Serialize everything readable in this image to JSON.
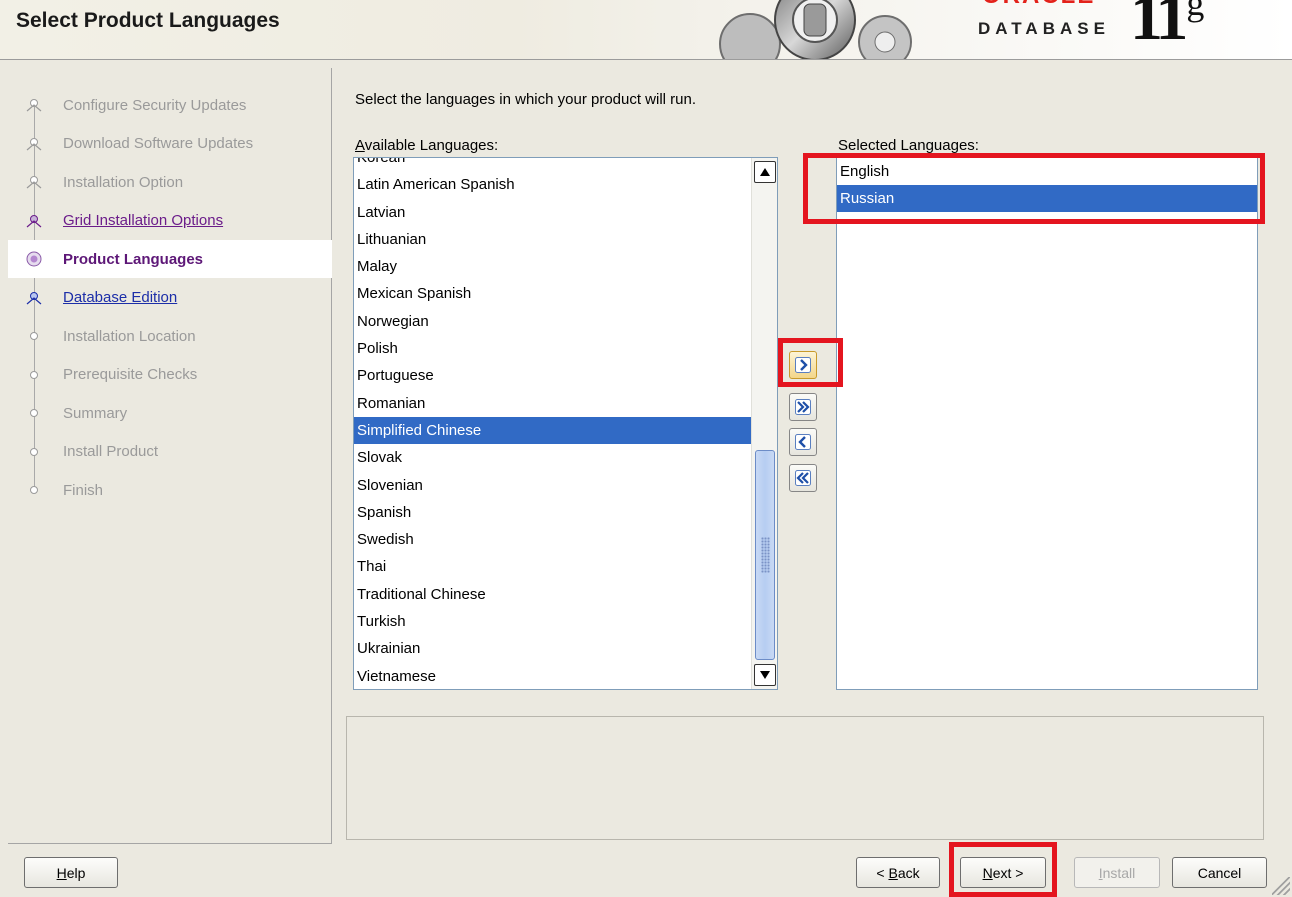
{
  "header": {
    "title": "Select Product Languages",
    "logo": {
      "brand": "ORACLE",
      "product": "DATABASE",
      "version": "11",
      "version_suffix": "g"
    }
  },
  "steps": [
    {
      "label": "Configure Security Updates",
      "state": "done"
    },
    {
      "label": "Download Software Updates",
      "state": "done"
    },
    {
      "label": "Installation Option",
      "state": "done"
    },
    {
      "label": "Grid Installation Options",
      "state": "visited-link"
    },
    {
      "label": "Product Languages",
      "state": "current"
    },
    {
      "label": "Database Edition",
      "state": "link"
    },
    {
      "label": "Installation Location",
      "state": "pending"
    },
    {
      "label": "Prerequisite Checks",
      "state": "pending"
    },
    {
      "label": "Summary",
      "state": "pending"
    },
    {
      "label": "Install Product",
      "state": "pending"
    },
    {
      "label": "Finish",
      "state": "pending"
    }
  ],
  "main": {
    "instruction": "Select the languages in which your product will run.",
    "available_label": "Available Languages:",
    "selected_label": "Selected Languages:",
    "available_languages": [
      "Korean",
      "Latin American Spanish",
      "Latvian",
      "Lithuanian",
      "Malay",
      "Mexican Spanish",
      "Norwegian",
      "Polish",
      "Portuguese",
      "Romanian",
      "Simplified Chinese",
      "Slovak",
      "Slovenian",
      "Spanish",
      "Swedish",
      "Thai",
      "Traditional Chinese",
      "Turkish",
      "Ukrainian",
      "Vietnamese"
    ],
    "available_selected": "Simplified Chinese",
    "selected_languages": [
      "English",
      "Russian"
    ],
    "selected_highlighted": "Russian"
  },
  "move_buttons": [
    {
      "name": "add-selected-button",
      "icon": "single-chevron-right"
    },
    {
      "name": "add-all-button",
      "icon": "double-chevron-right"
    },
    {
      "name": "remove-selected-button",
      "icon": "single-chevron-left"
    },
    {
      "name": "remove-all-button",
      "icon": "double-chevron-left"
    }
  ],
  "footer": {
    "help": "Help",
    "back": "< Back",
    "next": "Next >",
    "install": "Install",
    "cancel": "Cancel"
  },
  "colors": {
    "selection": "#316ac5",
    "highlight_box": "#e4151f",
    "current_step": "#5d1777",
    "link": "#1c2ea8"
  }
}
